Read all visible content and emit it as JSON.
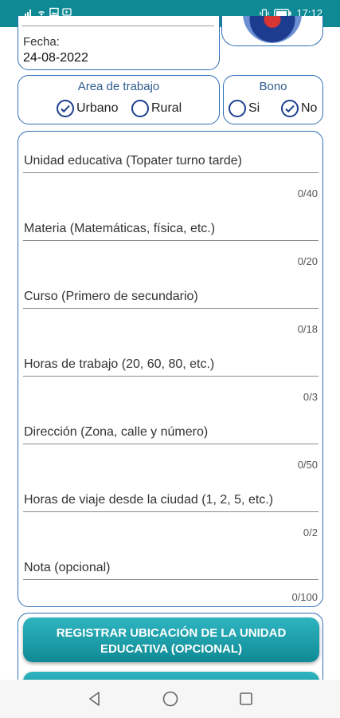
{
  "status_bar": {
    "time": "17:12",
    "icons": [
      "signal-icon",
      "wifi-icon",
      "image-notification-icon",
      "cast-icon",
      "vibrate-icon",
      "battery-icon"
    ]
  },
  "header": {
    "fecha_label": "Fecha:",
    "fecha_value": "24-08-2022"
  },
  "area_trabajo": {
    "title": "Area de trabajo",
    "options": [
      {
        "label": "Urbano",
        "selected": true
      },
      {
        "label": "Rural",
        "selected": false
      }
    ]
  },
  "bono": {
    "title": "Bono",
    "options": [
      {
        "label": "Si",
        "selected": false
      },
      {
        "label": "No",
        "selected": true
      }
    ]
  },
  "form": {
    "fields": [
      {
        "placeholder": "Unidad educativa (Topater turno tarde)",
        "counter": "0/40"
      },
      {
        "placeholder": "Materia (Matemáticas, física, etc.)",
        "counter": "0/20"
      },
      {
        "placeholder": "Curso (Primero de secundario)",
        "counter": "0/18"
      },
      {
        "placeholder": "Horas de trabajo (20, 60, 80, etc.)",
        "counter": "0/3"
      },
      {
        "placeholder": "Dirección (Zona, calle y número)",
        "counter": "0/50"
      },
      {
        "placeholder": "Horas de viaje desde la ciudad (1, 2, 5, etc.)",
        "counter": "0/2"
      },
      {
        "placeholder": "Nota (opcional)",
        "counter": "0/100"
      }
    ]
  },
  "actions": {
    "register_location_line1": "REGISTRAR UBICACIÓN DE LA UNIDAD",
    "register_location_line2": "EDUCATIVA (OPCIONAL)"
  },
  "nav": {
    "icons": [
      "back-icon",
      "home-icon",
      "recents-icon"
    ]
  },
  "colors": {
    "accent": "#0f8a95",
    "border": "#2f6fb3",
    "radio": "#1a3f8f"
  }
}
